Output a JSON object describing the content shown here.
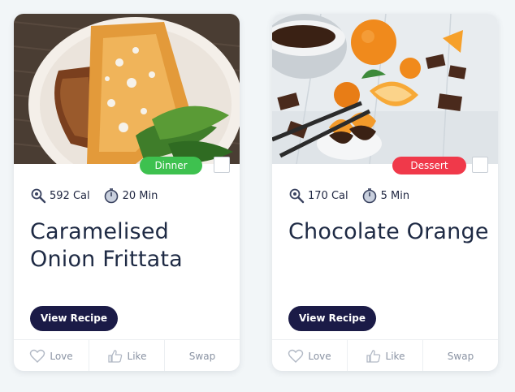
{
  "cards": [
    {
      "image_alt": "frittata-photo",
      "tag": {
        "label": "Dinner",
        "color": "#3ec14f"
      },
      "calories": "592 Cal",
      "time": "20 Min",
      "title_line1": "Caramelised",
      "title_line2": "Onion Frittata",
      "view_label": "View Recipe",
      "actions": {
        "love": "Love",
        "like": "Like",
        "swap": "Swap"
      }
    },
    {
      "image_alt": "chocolate-orange-photo",
      "tag": {
        "label": "Dessert",
        "color": "#f0394a"
      },
      "calories": "170 Cal",
      "time": "5 Min",
      "title_line1": "Chocolate Orange",
      "title_line2": "",
      "view_label": "View Recipe",
      "actions": {
        "love": "Love",
        "like": "Like",
        "swap": "Swap"
      }
    }
  ],
  "colors": {
    "navy": "#1b1b47",
    "text": "#1e2a44",
    "muted": "#8a93a3"
  }
}
